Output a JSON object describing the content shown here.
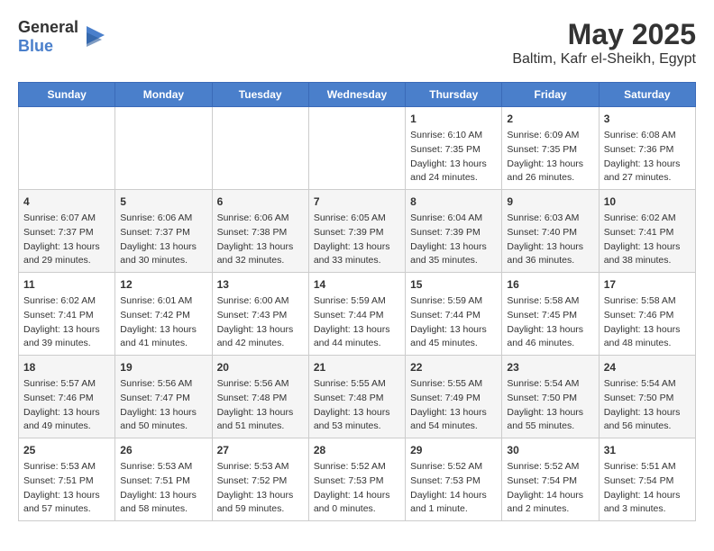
{
  "logo": {
    "text_general": "General",
    "text_blue": "Blue"
  },
  "title": "May 2025",
  "subtitle": "Baltim, Kafr el-Sheikh, Egypt",
  "days_of_week": [
    "Sunday",
    "Monday",
    "Tuesday",
    "Wednesday",
    "Thursday",
    "Friday",
    "Saturday"
  ],
  "weeks": [
    [
      {
        "day": "",
        "info": ""
      },
      {
        "day": "",
        "info": ""
      },
      {
        "day": "",
        "info": ""
      },
      {
        "day": "",
        "info": ""
      },
      {
        "day": "1",
        "info": "Sunrise: 6:10 AM\nSunset: 7:35 PM\nDaylight: 13 hours\nand 24 minutes."
      },
      {
        "day": "2",
        "info": "Sunrise: 6:09 AM\nSunset: 7:35 PM\nDaylight: 13 hours\nand 26 minutes."
      },
      {
        "day": "3",
        "info": "Sunrise: 6:08 AM\nSunset: 7:36 PM\nDaylight: 13 hours\nand 27 minutes."
      }
    ],
    [
      {
        "day": "4",
        "info": "Sunrise: 6:07 AM\nSunset: 7:37 PM\nDaylight: 13 hours\nand 29 minutes."
      },
      {
        "day": "5",
        "info": "Sunrise: 6:06 AM\nSunset: 7:37 PM\nDaylight: 13 hours\nand 30 minutes."
      },
      {
        "day": "6",
        "info": "Sunrise: 6:06 AM\nSunset: 7:38 PM\nDaylight: 13 hours\nand 32 minutes."
      },
      {
        "day": "7",
        "info": "Sunrise: 6:05 AM\nSunset: 7:39 PM\nDaylight: 13 hours\nand 33 minutes."
      },
      {
        "day": "8",
        "info": "Sunrise: 6:04 AM\nSunset: 7:39 PM\nDaylight: 13 hours\nand 35 minutes."
      },
      {
        "day": "9",
        "info": "Sunrise: 6:03 AM\nSunset: 7:40 PM\nDaylight: 13 hours\nand 36 minutes."
      },
      {
        "day": "10",
        "info": "Sunrise: 6:02 AM\nSunset: 7:41 PM\nDaylight: 13 hours\nand 38 minutes."
      }
    ],
    [
      {
        "day": "11",
        "info": "Sunrise: 6:02 AM\nSunset: 7:41 PM\nDaylight: 13 hours\nand 39 minutes."
      },
      {
        "day": "12",
        "info": "Sunrise: 6:01 AM\nSunset: 7:42 PM\nDaylight: 13 hours\nand 41 minutes."
      },
      {
        "day": "13",
        "info": "Sunrise: 6:00 AM\nSunset: 7:43 PM\nDaylight: 13 hours\nand 42 minutes."
      },
      {
        "day": "14",
        "info": "Sunrise: 5:59 AM\nSunset: 7:44 PM\nDaylight: 13 hours\nand 44 minutes."
      },
      {
        "day": "15",
        "info": "Sunrise: 5:59 AM\nSunset: 7:44 PM\nDaylight: 13 hours\nand 45 minutes."
      },
      {
        "day": "16",
        "info": "Sunrise: 5:58 AM\nSunset: 7:45 PM\nDaylight: 13 hours\nand 46 minutes."
      },
      {
        "day": "17",
        "info": "Sunrise: 5:58 AM\nSunset: 7:46 PM\nDaylight: 13 hours\nand 48 minutes."
      }
    ],
    [
      {
        "day": "18",
        "info": "Sunrise: 5:57 AM\nSunset: 7:46 PM\nDaylight: 13 hours\nand 49 minutes."
      },
      {
        "day": "19",
        "info": "Sunrise: 5:56 AM\nSunset: 7:47 PM\nDaylight: 13 hours\nand 50 minutes."
      },
      {
        "day": "20",
        "info": "Sunrise: 5:56 AM\nSunset: 7:48 PM\nDaylight: 13 hours\nand 51 minutes."
      },
      {
        "day": "21",
        "info": "Sunrise: 5:55 AM\nSunset: 7:48 PM\nDaylight: 13 hours\nand 53 minutes."
      },
      {
        "day": "22",
        "info": "Sunrise: 5:55 AM\nSunset: 7:49 PM\nDaylight: 13 hours\nand 54 minutes."
      },
      {
        "day": "23",
        "info": "Sunrise: 5:54 AM\nSunset: 7:50 PM\nDaylight: 13 hours\nand 55 minutes."
      },
      {
        "day": "24",
        "info": "Sunrise: 5:54 AM\nSunset: 7:50 PM\nDaylight: 13 hours\nand 56 minutes."
      }
    ],
    [
      {
        "day": "25",
        "info": "Sunrise: 5:53 AM\nSunset: 7:51 PM\nDaylight: 13 hours\nand 57 minutes."
      },
      {
        "day": "26",
        "info": "Sunrise: 5:53 AM\nSunset: 7:51 PM\nDaylight: 13 hours\nand 58 minutes."
      },
      {
        "day": "27",
        "info": "Sunrise: 5:53 AM\nSunset: 7:52 PM\nDaylight: 13 hours\nand 59 minutes."
      },
      {
        "day": "28",
        "info": "Sunrise: 5:52 AM\nSunset: 7:53 PM\nDaylight: 14 hours\nand 0 minutes."
      },
      {
        "day": "29",
        "info": "Sunrise: 5:52 AM\nSunset: 7:53 PM\nDaylight: 14 hours\nand 1 minute."
      },
      {
        "day": "30",
        "info": "Sunrise: 5:52 AM\nSunset: 7:54 PM\nDaylight: 14 hours\nand 2 minutes."
      },
      {
        "day": "31",
        "info": "Sunrise: 5:51 AM\nSunset: 7:54 PM\nDaylight: 14 hours\nand 3 minutes."
      }
    ]
  ]
}
